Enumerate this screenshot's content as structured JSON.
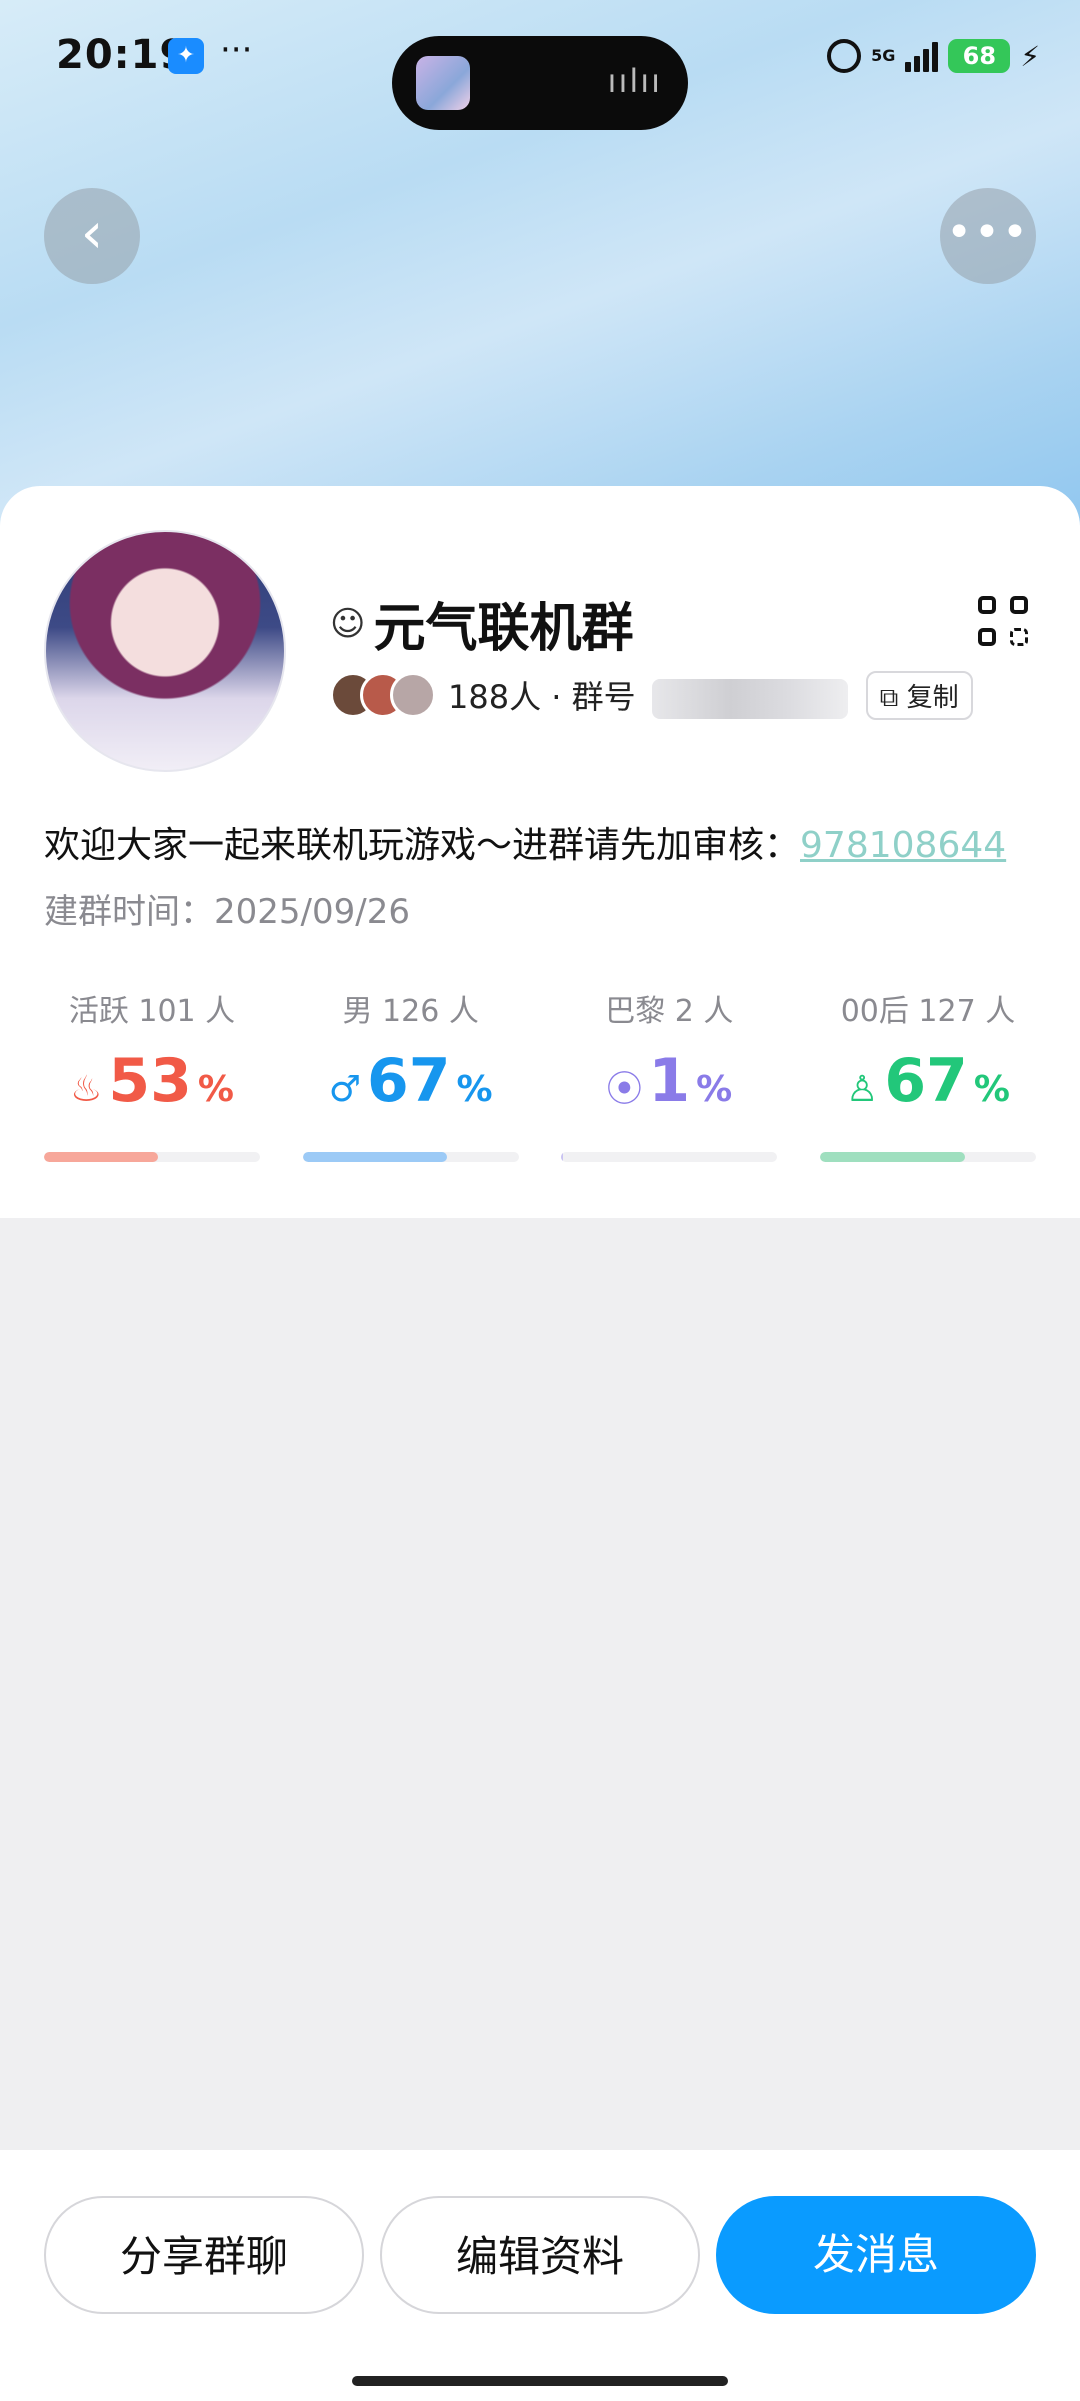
{
  "status_bar": {
    "time": "20:19",
    "network": "5G",
    "battery": "68"
  },
  "header": {
    "back_icon": "chevron-left-icon",
    "more_icon": "more-horizontal-icon"
  },
  "group": {
    "name": "元气联机群",
    "members": "188人",
    "id_label": "群号",
    "copy_label": "复制",
    "description": "欢迎大家一起来联机玩游戏～进群请先加审核：",
    "description_link": "978108644",
    "created": "建群时间：2025/09/26"
  },
  "stats": [
    {
      "label": "活跃 101 人",
      "value": "53",
      "unit": "%",
      "icon": "flame-icon",
      "color": "#f15a47",
      "fill_percent": 53
    },
    {
      "label": "男 126 人",
      "value": "67",
      "unit": "%",
      "icon": "male-icon",
      "color": "#1796ee",
      "fill_percent": 67
    },
    {
      "label": "巴黎 2 人",
      "value": "1",
      "unit": "%",
      "icon": "location-pin-icon",
      "color": "#8a7be8",
      "fill_percent": 1
    },
    {
      "label": "00后 127 人",
      "value": "67",
      "unit": "%",
      "icon": "person-icon",
      "color": "#22c77a",
      "fill_percent": 67
    }
  ],
  "bar_colors": [
    "#f7a79a",
    "#9ccaf6",
    "#c9c3f2",
    "#9fdfbf"
  ],
  "actions": {
    "share": "分享群聊",
    "edit": "编辑资料",
    "send": "发消息"
  }
}
